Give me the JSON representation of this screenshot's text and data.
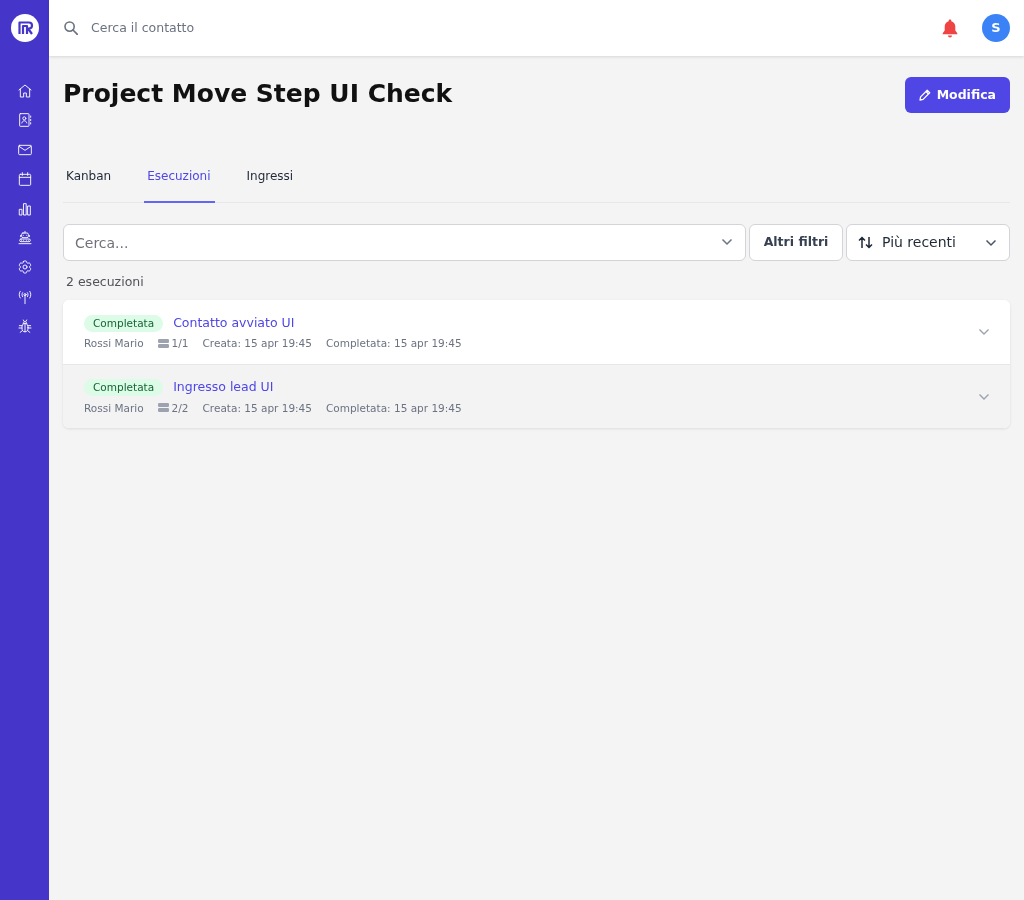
{
  "topbar": {
    "search": {
      "placeholder": "Cerca il contatto"
    },
    "avatar": "S"
  },
  "header": {
    "title": "Project Move Step UI Check",
    "edit_button": "Modifica"
  },
  "tabs": [
    {
      "label": "Kanban",
      "selected": false
    },
    {
      "label": "Esecuzioni",
      "selected": true
    },
    {
      "label": "Ingressi",
      "selected": false
    }
  ],
  "filters": {
    "search": {
      "placeholder": "Cerca..."
    },
    "more_filters_button": "Altri filtri",
    "sort": {
      "value": "Più recenti"
    }
  },
  "count": "2 esecuzioni",
  "executions": [
    {
      "status": "Completata",
      "title": "Contatto avviato UI",
      "user": "Rossi Mario",
      "steps": "1/1",
      "created": "Creata: 15 apr 19:45",
      "completed": "Completata: 15 apr 19:45",
      "highlighted": false
    },
    {
      "status": "Completata",
      "title": "Ingresso lead UI",
      "user": "Rossi Mario",
      "steps": "2/2",
      "created": "Creata: 15 apr 19:45",
      "completed": "Completata: 15 apr 19:45",
      "highlighted": true
    }
  ]
}
